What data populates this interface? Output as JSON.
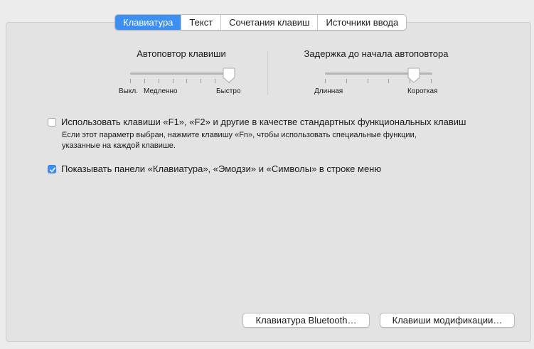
{
  "tabs": [
    {
      "label": "Клавиатура",
      "active": true
    },
    {
      "label": "Текст",
      "active": false
    },
    {
      "label": "Сочетания клавиш",
      "active": false
    },
    {
      "label": "Источники ввода",
      "active": false
    }
  ],
  "key_repeat": {
    "title": "Автоповтор клавиши",
    "labels": {
      "off": "Выкл.",
      "slow": "Медленно",
      "fast": "Быстро"
    },
    "value": 1.0
  },
  "repeat_delay": {
    "title": "Задержка до начала автоповтора",
    "labels": {
      "long": "Длинная",
      "short": "Короткая"
    },
    "value": 0.84
  },
  "fn_keys": {
    "label": "Использовать клавиши «F1», «F2» и другие в качестве стандартных функциональных клавиш",
    "hint_line1": "Если этот параметр выбран, нажмите клавишу «Fn», чтобы использовать специальные функции,",
    "hint_line2": "указанные на каждой клавише.",
    "checked": false
  },
  "menu_bar": {
    "label": "Показывать панели «Клавиатура», «Эмодзи» и «Символы» в строке меню",
    "checked": true
  },
  "buttons": {
    "bluetooth": "Клавиатура Bluetooth…",
    "modifiers": "Клавиши модификации…"
  },
  "colors": {
    "accent": "#3d8ff1"
  }
}
